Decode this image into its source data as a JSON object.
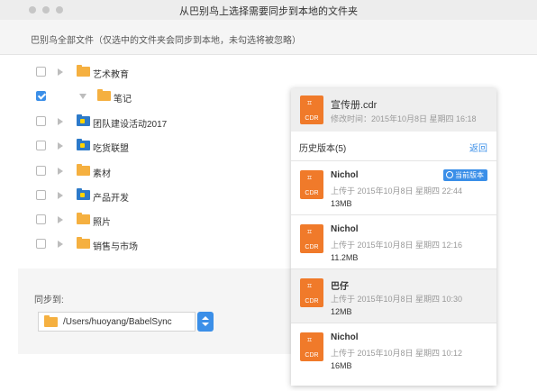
{
  "window": {
    "title": "从巴别鸟上选择需要同步到本地的文件夹"
  },
  "header": {
    "description": "巴别鸟全部文件（仅选中的文件夹会同步到本地，未勾选将被忽略）"
  },
  "folders": [
    {
      "label": "艺术教育",
      "checked": false,
      "expanded": false,
      "type": "folder"
    },
    {
      "label": "笔记",
      "checked": true,
      "expanded": true,
      "type": "folder"
    },
    {
      "label": "团队建设活动2017",
      "checked": false,
      "expanded": false,
      "type": "team-folder"
    },
    {
      "label": "吃货联盟",
      "checked": false,
      "expanded": false,
      "type": "team-folder"
    },
    {
      "label": "素材",
      "checked": false,
      "expanded": false,
      "type": "folder"
    },
    {
      "label": "产品开发",
      "checked": false,
      "expanded": false,
      "type": "team-folder"
    },
    {
      "label": "照片",
      "checked": false,
      "expanded": false,
      "type": "folder"
    },
    {
      "label": "销售与市场",
      "checked": false,
      "expanded": false,
      "type": "folder"
    }
  ],
  "sync": {
    "label": "同步到:",
    "path": "/Users/huoyang/BabelSync"
  },
  "popover": {
    "file_name": "宣传册.cdr",
    "modified": "修改时间：2015年10月8日 星期四 16:18",
    "history_label": "历史版本(5)",
    "back_label": "返回",
    "icon_label": "CDR",
    "versions": [
      {
        "name": "Nichol",
        "date": "上传于 2015年10月8日 星期四 22:44",
        "size": "13MB",
        "current_label": "当前版本"
      },
      {
        "name": "Nichol",
        "date": "上传于 2015年10月8日 星期四 12:16",
        "size": "11.2MB"
      },
      {
        "name": "巴仔",
        "date": "上传于 2015年10月8日 星期四 10:30",
        "size": "12MB"
      },
      {
        "name": "Nichol",
        "date": "上传于 2015年10月8日 星期四 10:12",
        "size": "16MB"
      }
    ]
  },
  "colors": {
    "accent": "#3b8fe8",
    "folder": "#f5b040",
    "team_folder": "#2d7ac9",
    "cdr_icon": "#f07a2a"
  }
}
